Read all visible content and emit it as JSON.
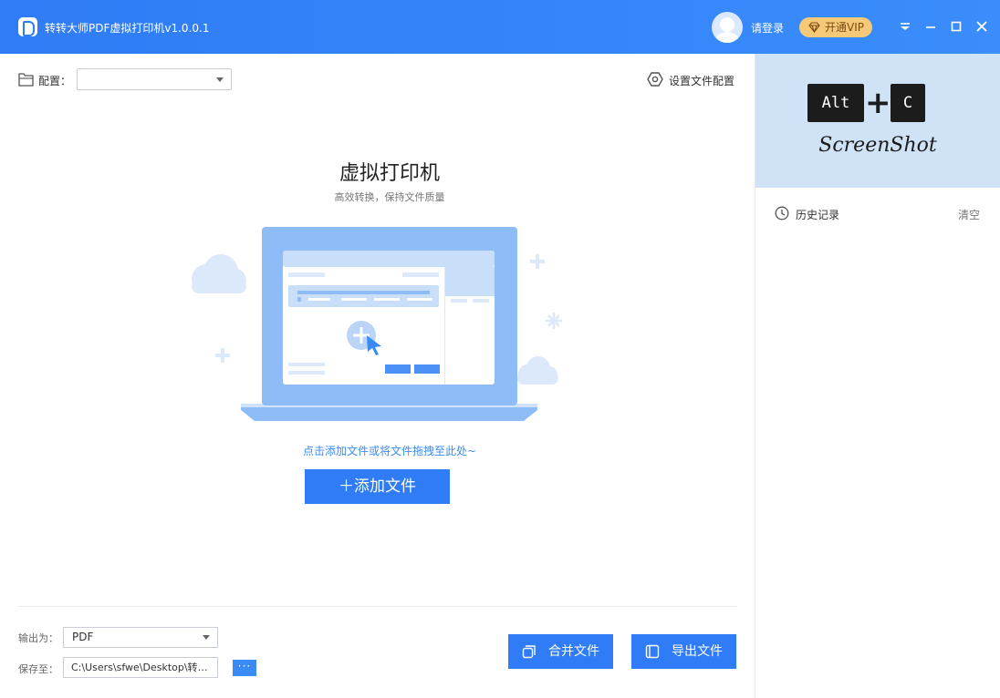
{
  "titlebar": {
    "title": "转转大师PDF虚拟打印机v1.0.0.1",
    "login_label": "请登录",
    "vip_label": "开通VIP"
  },
  "config": {
    "label": "配置：",
    "selected_value": "",
    "settings_label": "设置文件配置"
  },
  "hero": {
    "title": "虚拟打印机",
    "subtitle": "高效转换，保持文件质量"
  },
  "drop_hint": "点击添加文件或将文件拖拽至此处~",
  "add_file_label": "＋添加文件",
  "output": {
    "format_label": "输出为：",
    "format_value": "PDF",
    "save_label": "保存至：",
    "save_path": "C:\\Users\\sfwe\\Desktop\\转转...",
    "browse_label": "···"
  },
  "actions": {
    "merge_label": "合并文件",
    "export_label": "导出文件"
  },
  "right_panel": {
    "key_alt": "Alt",
    "key_plus": "+",
    "key_c": "C",
    "screenshot_text": "ScreenShot",
    "history_label": "历史记录",
    "clear_label": "清空"
  },
  "colors": {
    "primary": "#2f7cf6",
    "vip_gold": "#f5c977",
    "hint_blue": "#3b8cf3",
    "banner_bg": "#cfe2f6"
  }
}
